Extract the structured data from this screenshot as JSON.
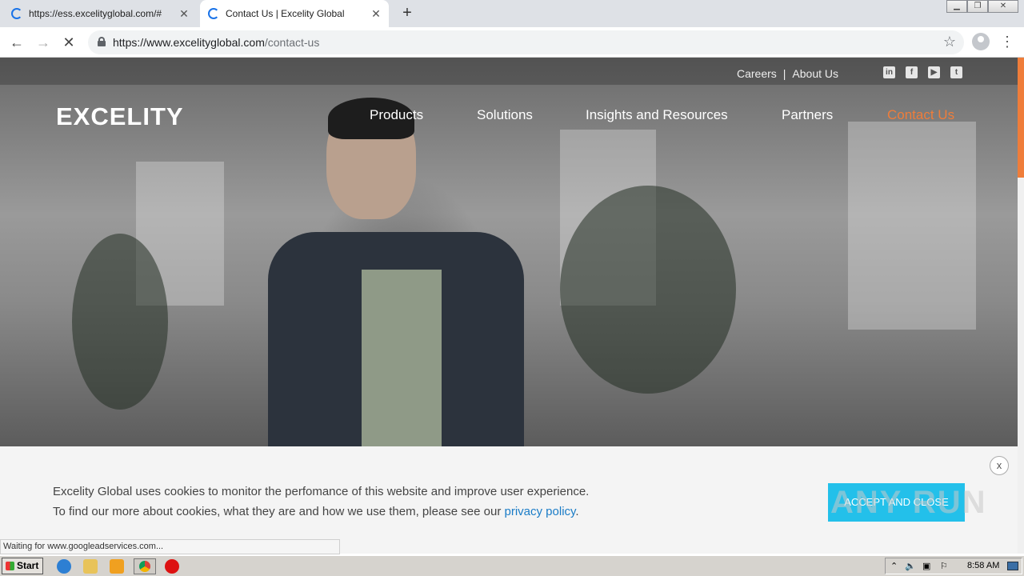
{
  "browser": {
    "tabs": [
      {
        "title": "https://ess.excelityglobal.com/#",
        "close": "✕"
      },
      {
        "title": "Contact Us | Excelity Global",
        "close": "✕"
      }
    ],
    "new_tab": "+",
    "url_host": "https://www.excelityglobal.com",
    "url_path": "/contact-us",
    "status_text": "Waiting for www.googleadservices.com..."
  },
  "site": {
    "top_links": [
      "Careers",
      "About Us"
    ],
    "top_sep": "|",
    "socials": [
      "in",
      "f",
      "▶",
      "t"
    ],
    "logo": "EXCELITY",
    "nav": [
      "Products",
      "Solutions",
      "Insights and Resources",
      "Partners",
      "Contact Us"
    ],
    "accent_color": "#ef7d3a"
  },
  "cookie": {
    "line1": "Excelity Global uses cookies to monitor the perfomance of this website and improve user experience.",
    "line2_prefix": "To find our more about cookies, what they are and how we use them, please see our ",
    "link": "privacy policy",
    "line2_suffix": ".",
    "close": "x",
    "button": "ACCEPT AND CLOSE"
  },
  "watermark": "ANY RUN",
  "taskbar": {
    "start": "Start",
    "clock": "8:58 AM"
  }
}
